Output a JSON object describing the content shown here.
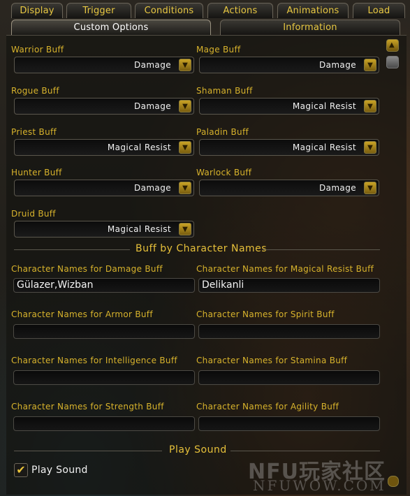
{
  "tabs_row1": [
    "Display",
    "Trigger",
    "Conditions",
    "Actions",
    "Animations",
    "Load"
  ],
  "tabs_row2": [
    "Custom Options",
    "Information"
  ],
  "class_buffs": {
    "warrior": {
      "label": "Warrior Buff",
      "value": "Damage"
    },
    "mage": {
      "label": "Mage Buff",
      "value": "Damage"
    },
    "rogue": {
      "label": "Rogue Buff",
      "value": "Damage"
    },
    "shaman": {
      "label": "Shaman Buff",
      "value": "Magical Resist"
    },
    "priest": {
      "label": "Priest Buff",
      "value": "Magical Resist"
    },
    "paladin": {
      "label": "Paladin Buff",
      "value": "Magical Resist"
    },
    "hunter": {
      "label": "Hunter Buff",
      "value": "Damage"
    },
    "warlock": {
      "label": "Warlock Buff",
      "value": "Damage"
    },
    "druid": {
      "label": "Druid Buff",
      "value": "Magical Resist"
    }
  },
  "name_section": {
    "heading": "Buff by Character Names",
    "damage": {
      "label": "Character Names for Damage Buff",
      "value": "Gülazer,Wizban"
    },
    "magical_resist": {
      "label": "Character Names for Magical Resist Buff",
      "value": "Delikanli"
    },
    "armor": {
      "label": "Character Names for Armor Buff",
      "value": ""
    },
    "spirit": {
      "label": "Character Names for Spirit Buff",
      "value": ""
    },
    "intelligence": {
      "label": "Character Names for Intelligence Buff",
      "value": ""
    },
    "stamina": {
      "label": "Character Names for Stamina Buff",
      "value": ""
    },
    "strength": {
      "label": "Character Names for Strength Buff",
      "value": ""
    },
    "agility": {
      "label": "Character Names for Agility Buff",
      "value": ""
    }
  },
  "sound_section": {
    "heading": "Play Sound",
    "checkbox_label": "Play Sound",
    "checked": true
  },
  "watermark": {
    "brand": "NFU玩家社区",
    "site": "NFUWOW.COM"
  },
  "icons": [
    "chevron-down-icon",
    "scroll-up-icon",
    "checkmark-icon"
  ],
  "colors": {
    "label_gold": "#d8b32c",
    "heading_gold": "#e6c03a",
    "text_white": "#f2f2f2"
  }
}
